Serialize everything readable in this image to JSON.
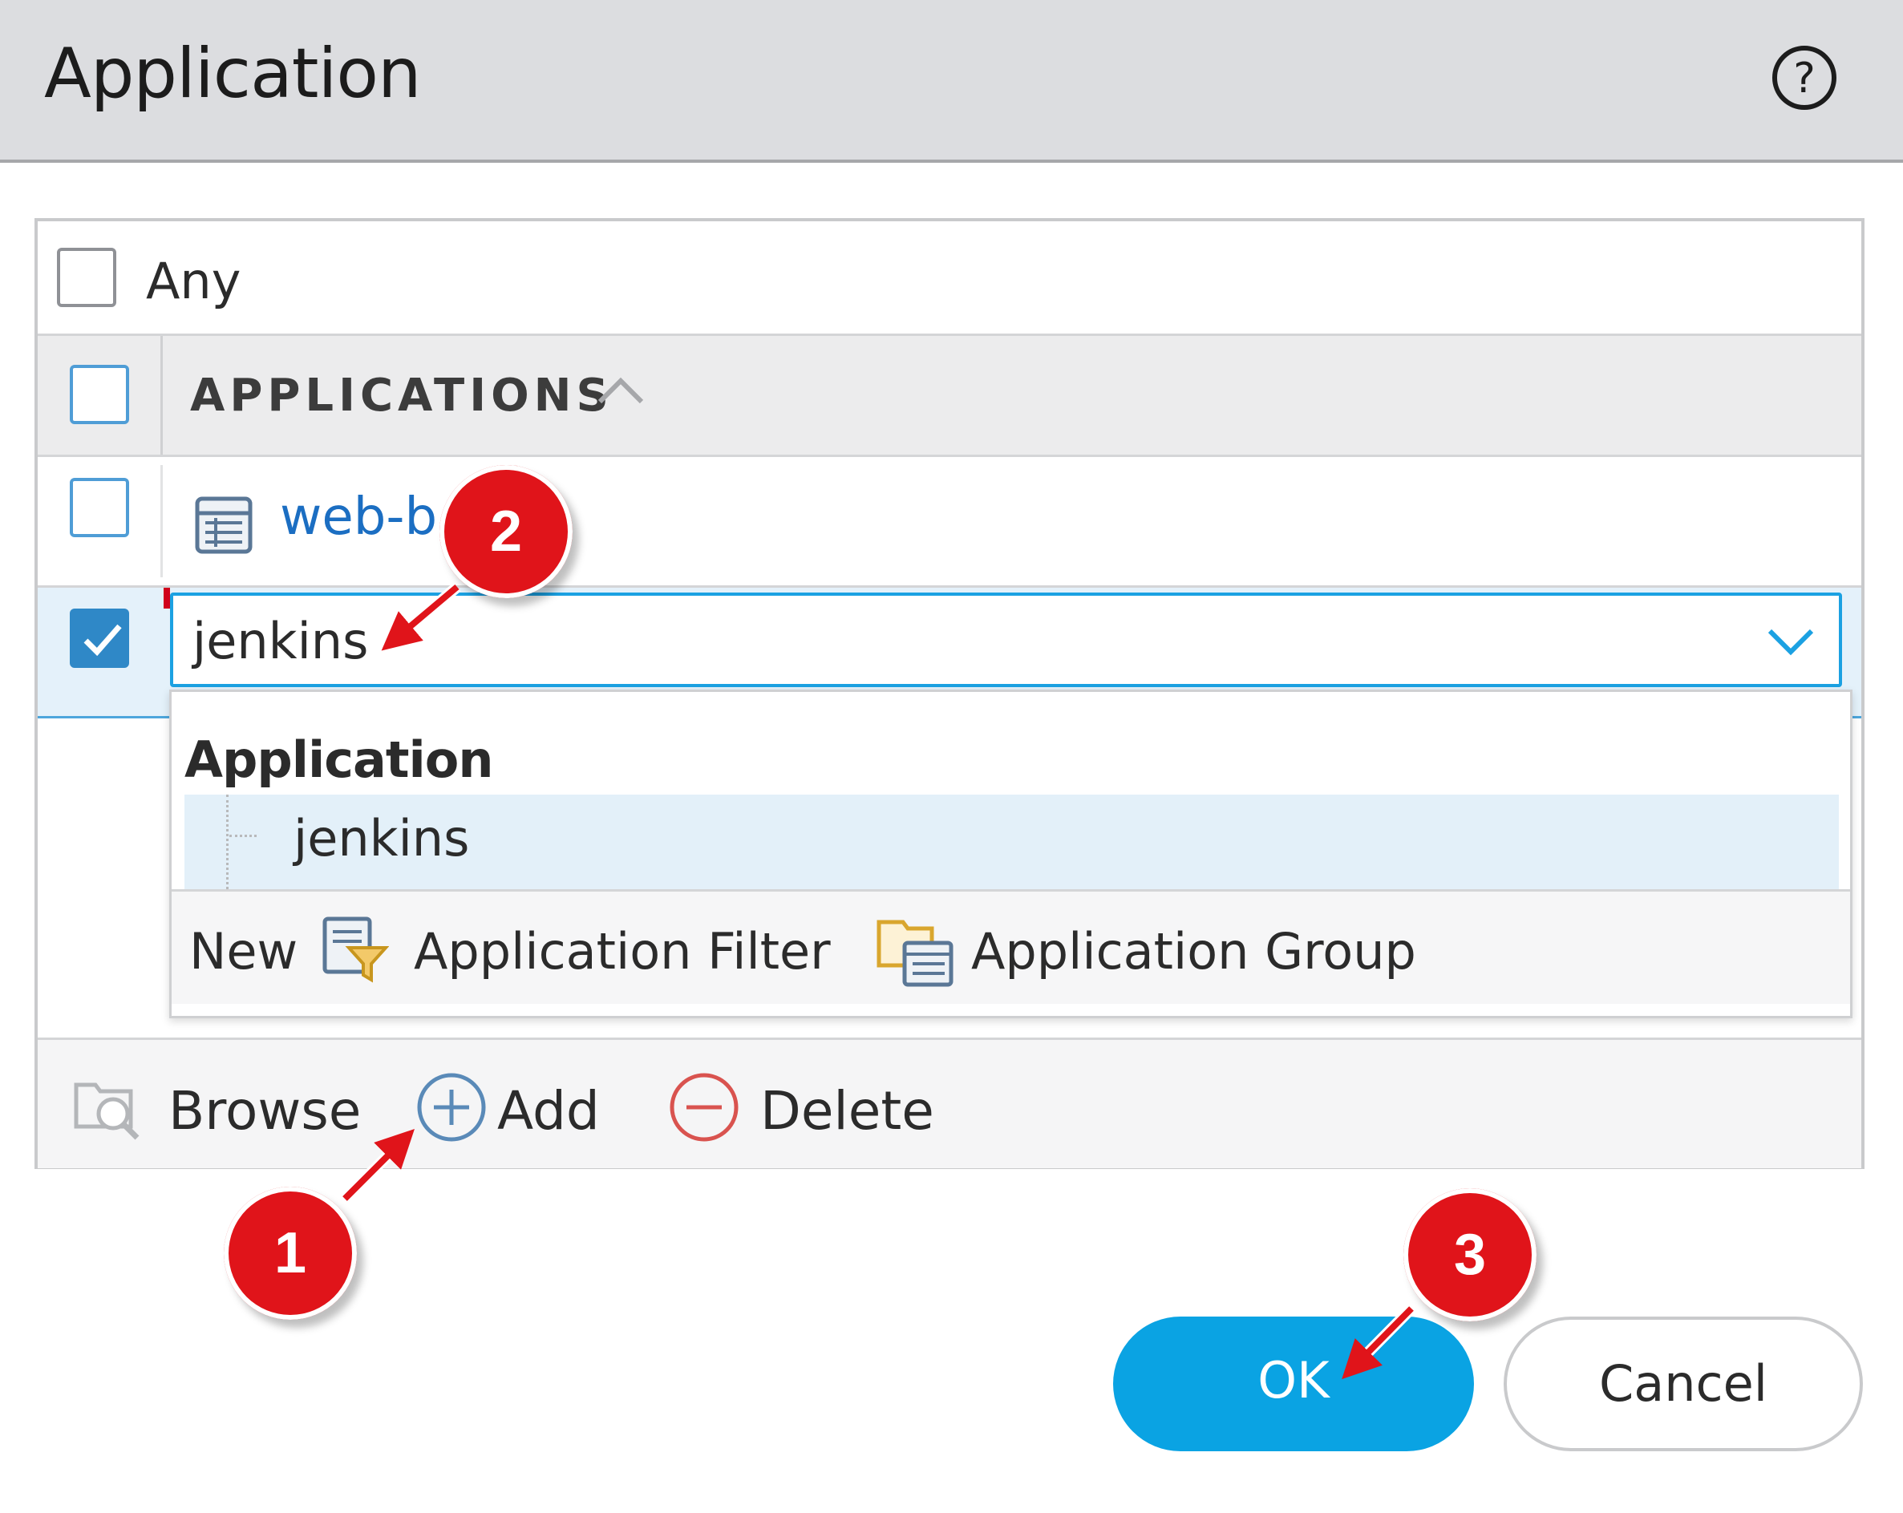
{
  "dialog": {
    "title": "Application"
  },
  "any": {
    "label": "Any"
  },
  "table": {
    "column_header": "APPLICATIONS",
    "rows": [
      {
        "label": "web-b…g"
      },
      {
        "value": "jenkins"
      }
    ]
  },
  "dropdown": {
    "group_label": "Application",
    "item_label": "jenkins",
    "footer": {
      "new_label": "New",
      "filter_label": "Application Filter",
      "group_label": "Application Group"
    }
  },
  "toolbar": {
    "browse_label": "Browse",
    "add_label": "Add",
    "delete_label": "Delete"
  },
  "buttons": {
    "ok_label": "OK",
    "cancel_label": "Cancel"
  },
  "callouts": [
    "1",
    "2",
    "3"
  ],
  "colors": {
    "accent": "#0aa3e3",
    "link": "#1b6ec2",
    "callout": "#e0141a",
    "delete": "#d9534f"
  },
  "icons": [
    "help-icon",
    "sort-up-icon",
    "table-icon",
    "chevron-down-icon",
    "filter-icon",
    "group-icon",
    "browse-icon",
    "add-icon",
    "delete-icon",
    "checkmark-icon"
  ]
}
